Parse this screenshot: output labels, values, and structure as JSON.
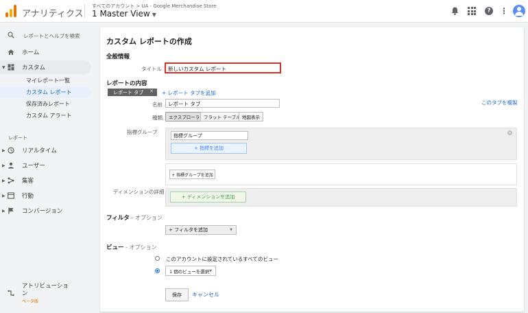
{
  "header": {
    "app_title": "アナリティクス",
    "breadcrumb": "すべてのアカウント > UA - Google Merchandise Store",
    "view_name": "1 Master View",
    "icons": [
      "bell-icon",
      "apps-grid-icon",
      "help-icon",
      "more-vert-icon",
      "account-avatar"
    ]
  },
  "sidebar": {
    "search_placeholder": "レポートとヘルプを検索",
    "home": "ホーム",
    "customization": "カスタム",
    "sub_items": [
      "マイレポート一覧",
      "カスタム レポート",
      "保存済みレポート",
      "カスタム アラート"
    ],
    "reports_header": "レポート",
    "reports": [
      "リアルタイム",
      "ユーザー",
      "集客",
      "行動",
      "コンバージョン"
    ],
    "attribution": "アトリビューション",
    "attribution_badge": "ベータ版"
  },
  "main": {
    "page_title": "カスタム レポートの作成",
    "general_info": "全般情報",
    "title_label": "タイトル",
    "title_value": "新しいカスタム レポート",
    "report_content": "レポートの内容",
    "report_tab": "レポート タブ",
    "add_report_tab": "+ レポート タブを追加",
    "duplicate_tab": "このタブを複製",
    "name_label": "名前",
    "name_value": "レポート タブ",
    "type_label": "種類",
    "types": [
      "エクスプローラ",
      "フラット テーブル",
      "地図表示"
    ],
    "metric_group_label": "指標グループ",
    "metric_group_value": "指標グループ",
    "add_metric": "+ 指標を追加",
    "add_metric_group": "+ 指標グループを追加",
    "dimension_label": "ディメンションの詳細",
    "add_dimension": "+ ディメンションを追加",
    "filter_title": "フィルタ",
    "filter_optional": " - オプション",
    "add_filter": "+ フィルタを追加",
    "view_title": "ビュー",
    "view_optional": " - オプション",
    "view_option_all": "このアカウントに設定されているすべてのビュー",
    "view_option_select": "1 個のビューを選択",
    "save": "保存",
    "cancel": "キャンセル"
  }
}
